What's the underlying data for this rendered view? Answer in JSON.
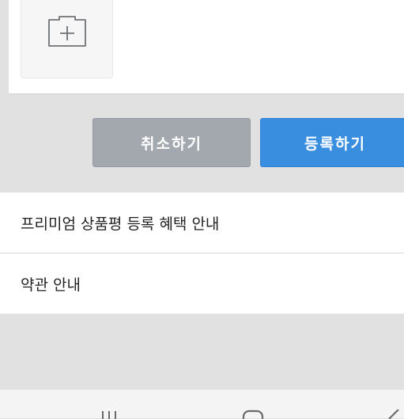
{
  "upload": {
    "add_photo_icon": "camera-plus-icon"
  },
  "actions": {
    "cancel_label": "취소하기",
    "submit_label": "등록하기"
  },
  "info": {
    "items": [
      {
        "label": "프리미엄 상품평 등록 혜택 안내"
      },
      {
        "label": "약관 안내"
      }
    ]
  },
  "nav": {
    "recent_icon": "recent-apps-icon",
    "home_icon": "home-icon",
    "back_icon": "back-icon"
  },
  "colors": {
    "submit": "#3a8ee0",
    "cancel": "#a3a8ae"
  }
}
